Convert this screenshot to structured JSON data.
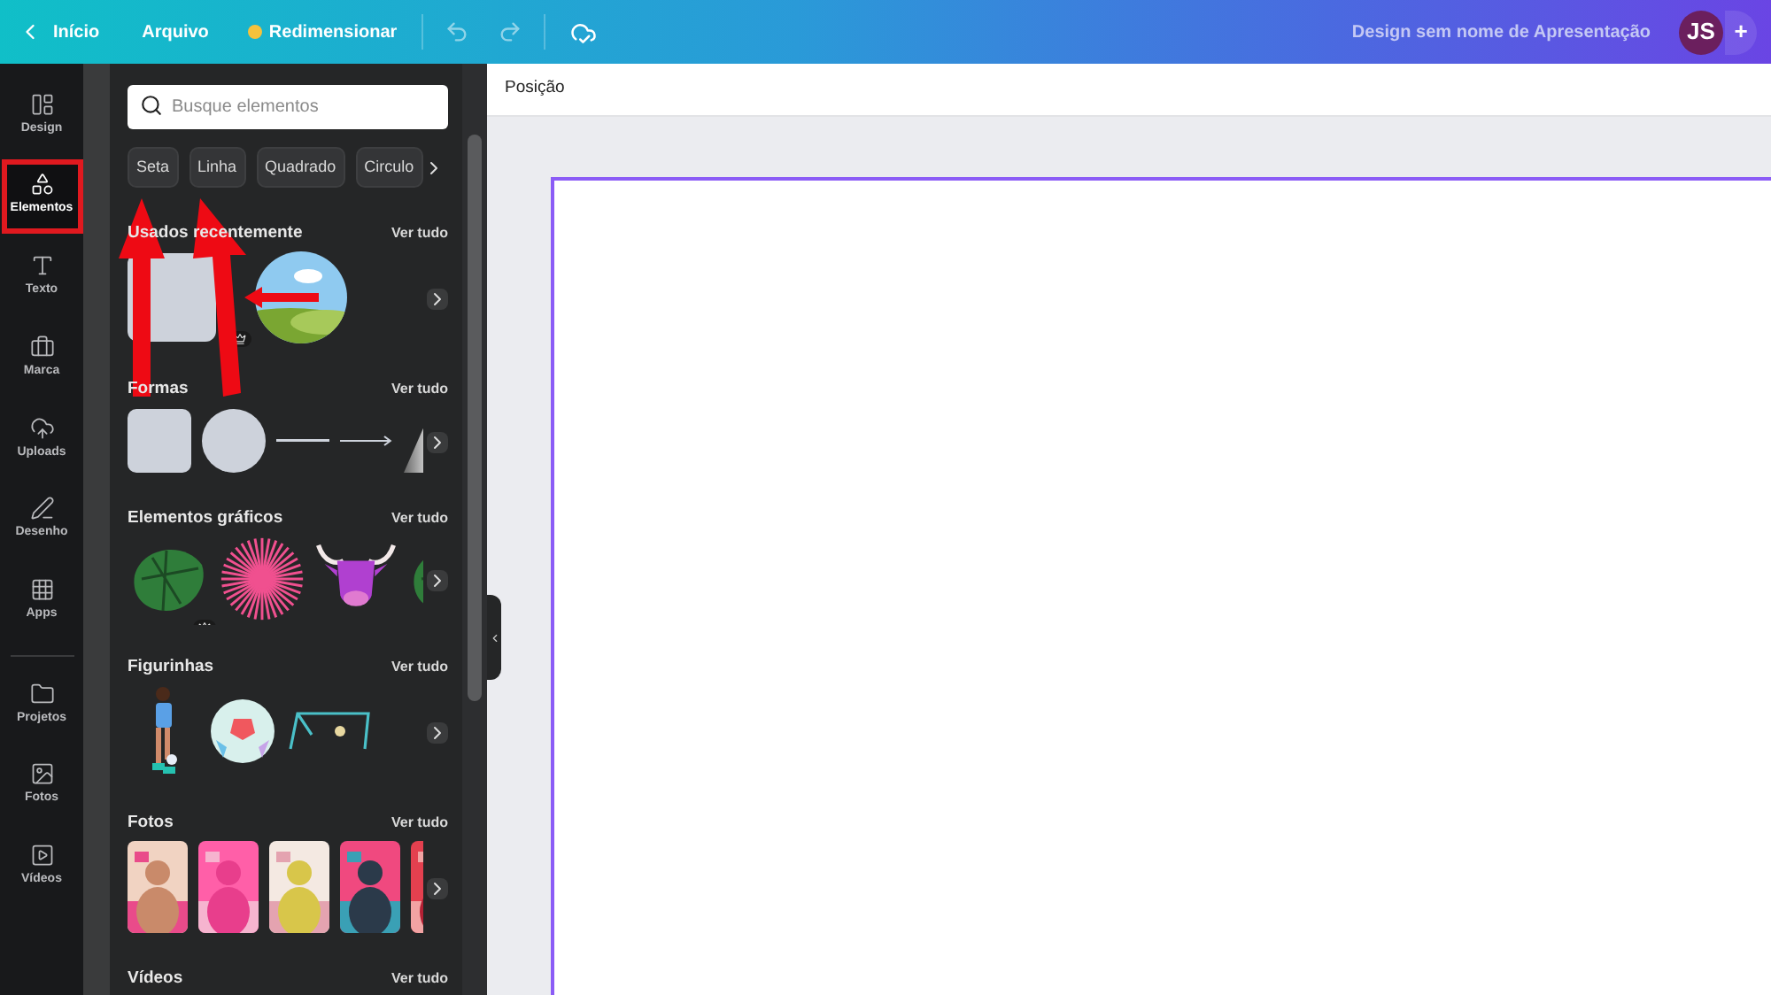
{
  "topbar": {
    "back": "Início",
    "menu": "Arquivo",
    "resize": "Redimensionar",
    "title": "Design sem nome de Apresentação",
    "avatar": "JS",
    "add": "+"
  },
  "rail": [
    {
      "label": "Design",
      "selected": false
    },
    {
      "label": "Elementos",
      "selected": true
    },
    {
      "label": "Texto",
      "selected": false
    },
    {
      "label": "Marca",
      "selected": false
    },
    {
      "label": "Uploads",
      "selected": false
    },
    {
      "label": "Desenho",
      "selected": false
    },
    {
      "label": "Apps",
      "selected": false
    },
    {
      "label": "Projetos",
      "selected": false
    },
    {
      "label": "Fotos",
      "selected": false
    },
    {
      "label": "Vídeos",
      "selected": false
    }
  ],
  "panel": {
    "search": {
      "placeholder": "Busque elementos"
    },
    "chips": [
      "Seta",
      "Linha",
      "Quadrado",
      "Circulo"
    ],
    "sections": [
      {
        "title": "Usados recentemente",
        "see_all": "Ver tudo",
        "items": [
          {
            "kind": "tile"
          },
          {
            "kind": "blank",
            "premium": true
          },
          {
            "kind": "sky-circle"
          }
        ]
      },
      {
        "title": "Formas",
        "see_all": "Ver tudo",
        "items": [
          {
            "kind": "square"
          },
          {
            "kind": "circle"
          },
          {
            "kind": "line"
          },
          {
            "kind": "arrow-line"
          },
          {
            "kind": "triangle"
          }
        ]
      },
      {
        "title": "Elementos gráficos",
        "see_all": "Ver tudo",
        "items": [
          {
            "kind": "leaf",
            "premium": true
          },
          {
            "kind": "burst"
          },
          {
            "kind": "bull"
          },
          {
            "kind": "leaf"
          }
        ]
      },
      {
        "title": "Figurinhas",
        "see_all": "Ver tudo",
        "items": [
          {
            "kind": "player"
          },
          {
            "kind": "ball"
          },
          {
            "kind": "goal"
          }
        ]
      },
      {
        "title": "Fotos",
        "see_all": "Ver tudo"
      },
      {
        "title": "Vídeos",
        "see_all": "Ver tudo"
      }
    ]
  },
  "toolbar": {
    "label": "Posição"
  }
}
